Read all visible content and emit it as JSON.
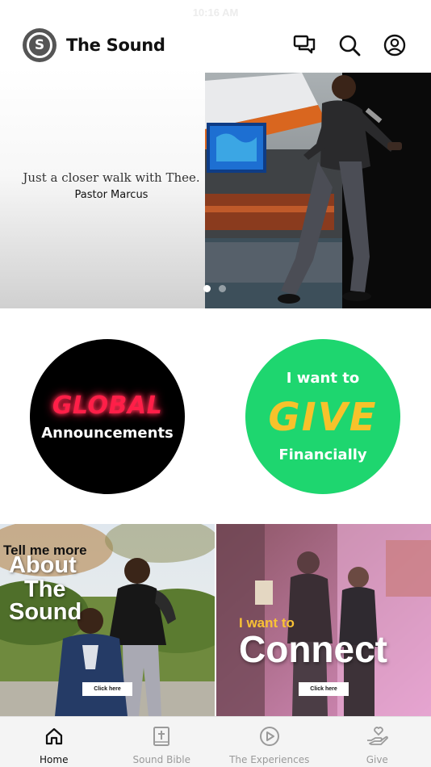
{
  "status_bar": {
    "time": "10:16 AM"
  },
  "header": {
    "logo_glyph": "S",
    "title": "The Sound",
    "actions": [
      "chat-icon",
      "search-icon",
      "profile-icon"
    ]
  },
  "hero": {
    "quote": "Just a closer walk with Thee.",
    "author": "Pastor Marcus",
    "slide_count": 2,
    "active_slide": 1
  },
  "buttons": {
    "global": {
      "line1": "GLOBAL",
      "line2": "Announcements",
      "bg": "#000000",
      "accent": "#ff1f48"
    },
    "give": {
      "line1": "I want to",
      "line2": "GIVE",
      "line3": "Financially",
      "bg": "#1ed66f",
      "accent": "#f7c22b"
    }
  },
  "tiles": {
    "about": {
      "small": "Tell me more",
      "line1": "About",
      "line2": "The",
      "line3": "Sound",
      "cta": "Click here"
    },
    "connect": {
      "small": "I want to",
      "big": "Connect",
      "cta": "Click here"
    }
  },
  "tab_bar": {
    "items": [
      {
        "label": "Home",
        "icon": "home-icon",
        "active": true
      },
      {
        "label": "Sound Bible",
        "icon": "bible-icon",
        "active": false
      },
      {
        "label": "The Experiences",
        "icon": "play-icon",
        "active": false
      },
      {
        "label": "Give",
        "icon": "give-heart-hand-icon",
        "active": false
      }
    ]
  }
}
